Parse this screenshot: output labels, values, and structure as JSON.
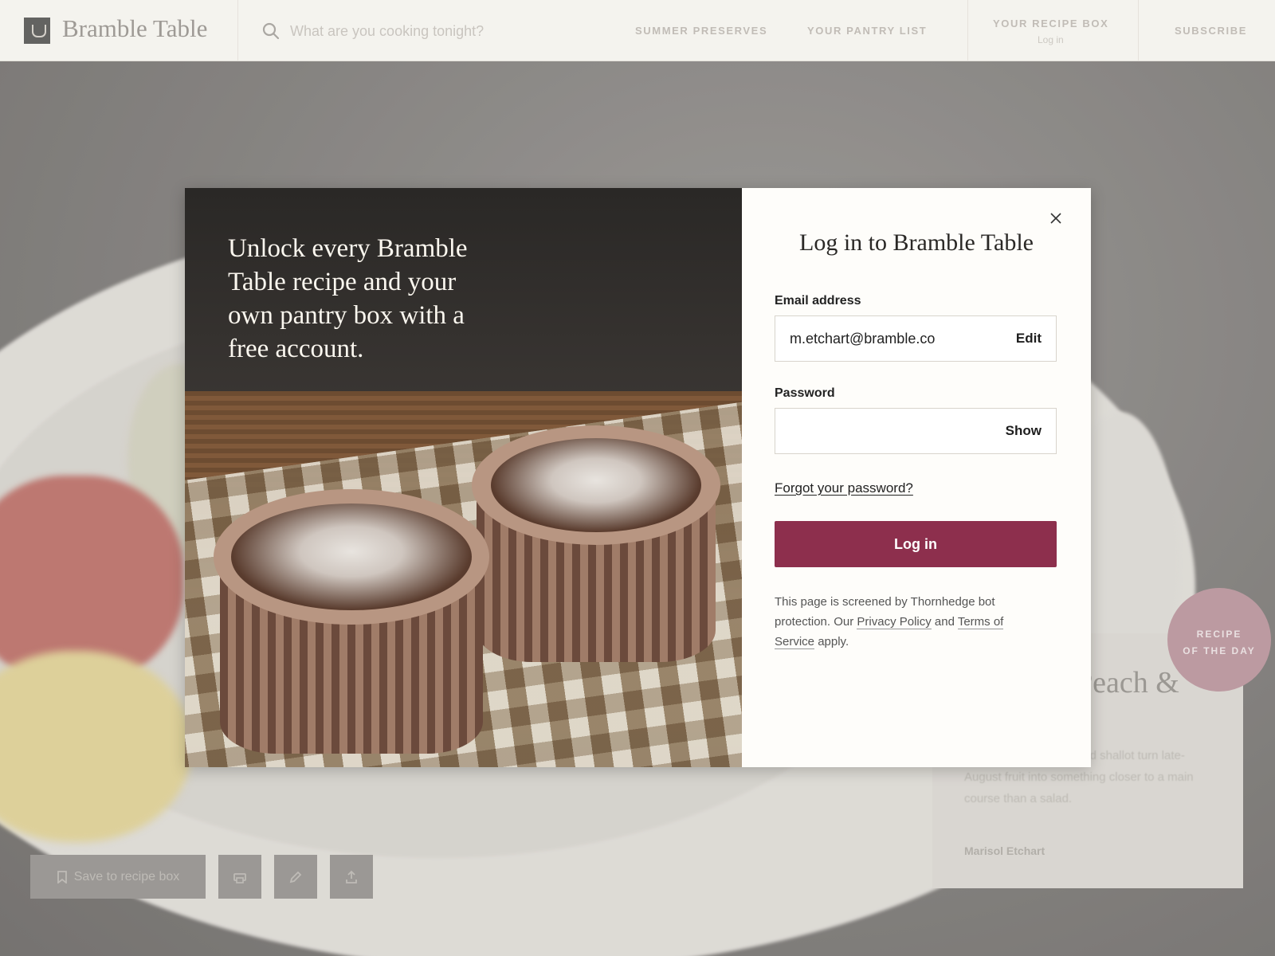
{
  "header": {
    "brand": "Bramble Table",
    "search": {
      "placeholder": "What are you cooking tonight?",
      "value": ""
    },
    "nav": [
      {
        "label": "SUMMER PRESERVES"
      },
      {
        "label": "YOUR PANTRY LIST"
      }
    ],
    "recipe_box": {
      "label": "YOUR RECIPE BOX",
      "sub": "Log in"
    },
    "subscribe": "SUBSCRIBE"
  },
  "background": {
    "card": {
      "title": "Peach &",
      "text": "and a spoonful of pickled shallot turn late-August fruit into something closer to a main course than a salad.",
      "author": "Marisol Etchart"
    },
    "badge": {
      "line1": "RECIPE",
      "line2": "OF THE DAY"
    },
    "actions": {
      "save_label": "Save to recipe box"
    }
  },
  "modal": {
    "media_heading": "Unlock every Bramble Table recipe and your own pantry box with a free account.",
    "title": "Log in to Bramble Table",
    "email": {
      "label": "Email address",
      "value": "m.etchart@bramble.co",
      "action": "Edit"
    },
    "password": {
      "label": "Password",
      "value": "",
      "action": "Show"
    },
    "forgot": "Forgot your password?",
    "submit": "Log in",
    "legal": {
      "prefix": "This page is screened by Thornhedge bot protection. Our ",
      "privacy": "Privacy Policy",
      "and": " and ",
      "terms": "Terms of Service",
      "suffix": " apply."
    }
  },
  "colors": {
    "primary": "#8d2f4d",
    "badge": "#b28a92",
    "header_bg": "#f3f1ec",
    "modal_bg": "#fefdfa"
  },
  "icons": [
    "logo-icon",
    "search-icon",
    "close-icon",
    "bookmark-icon",
    "print-icon",
    "pencil-icon",
    "share-icon"
  ]
}
